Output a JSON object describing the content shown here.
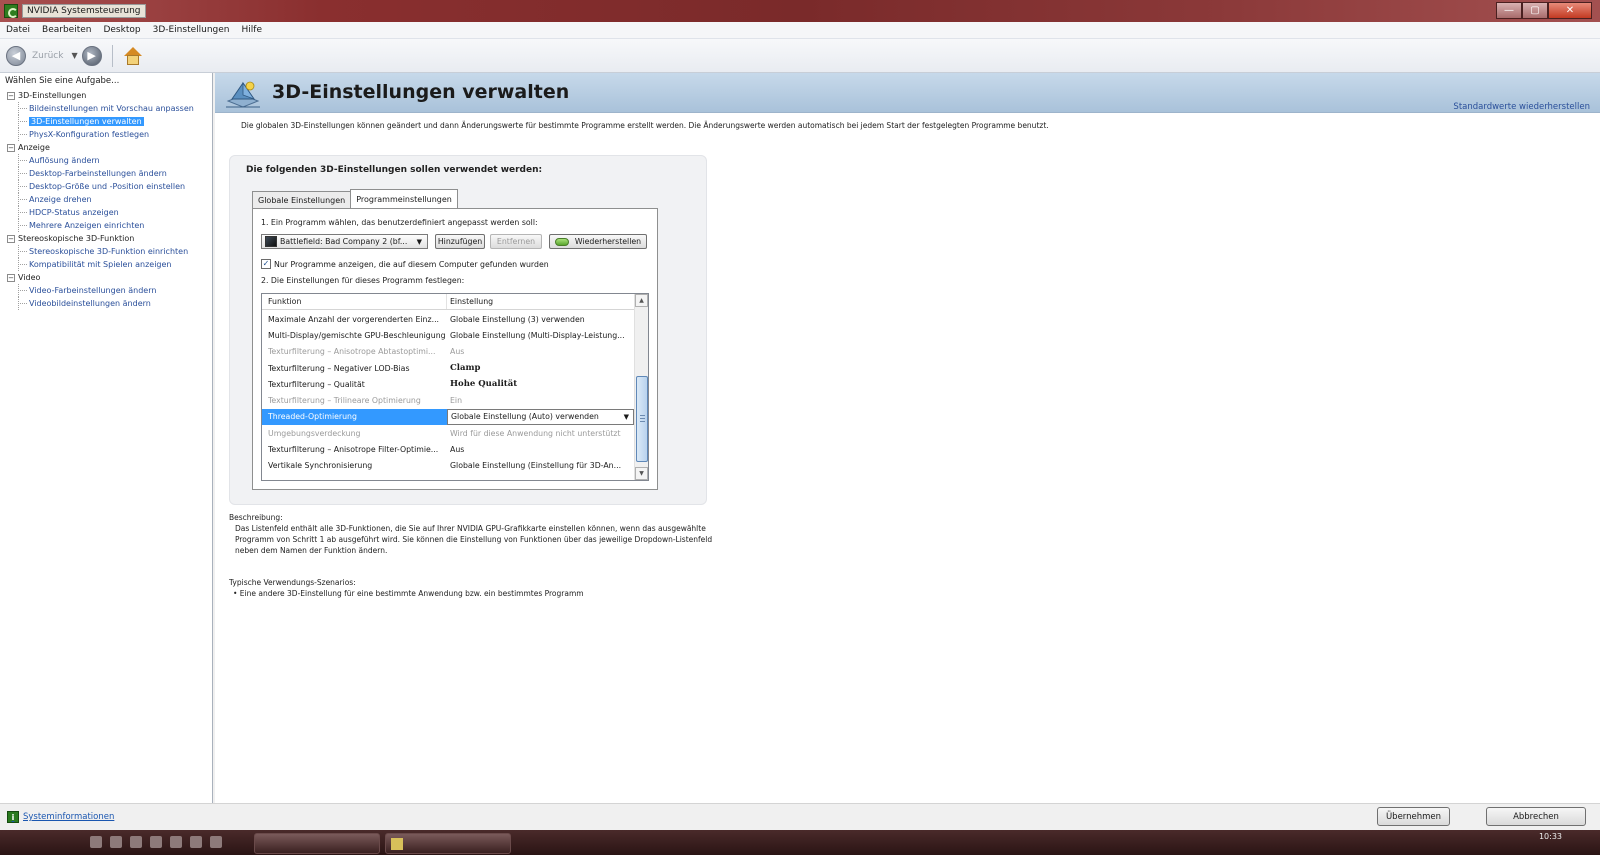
{
  "window": {
    "title": "NVIDIA Systemsteuerung",
    "controls": {
      "minimize": "—",
      "maximize": "▢",
      "close": "✕"
    }
  },
  "menu": [
    "Datei",
    "Bearbeiten",
    "Desktop",
    "3D-Einstellungen",
    "Hilfe"
  ],
  "toolbar": {
    "back_label": "Zurück",
    "back_icon": "◀",
    "forward_icon": "▶",
    "dropdown_icon": "▼"
  },
  "sidebar": {
    "title": "Wählen Sie eine Aufgabe...",
    "categories": [
      {
        "label": "3D-Einstellungen",
        "items": [
          {
            "label": "Bildeinstellungen mit Vorschau anpassen",
            "selected": false
          },
          {
            "label": "3D-Einstellungen verwalten",
            "selected": true
          },
          {
            "label": "PhysX-Konfiguration festlegen",
            "selected": false
          }
        ]
      },
      {
        "label": "Anzeige",
        "items": [
          {
            "label": "Auflösung ändern",
            "selected": false
          },
          {
            "label": "Desktop-Farbeinstellungen ändern",
            "selected": false
          },
          {
            "label": "Desktop-Größe und -Position einstellen",
            "selected": false
          },
          {
            "label": "Anzeige drehen",
            "selected": false
          },
          {
            "label": "HDCP-Status anzeigen",
            "selected": false
          },
          {
            "label": "Mehrere Anzeigen einrichten",
            "selected": false
          }
        ]
      },
      {
        "label": "Stereoskopische 3D-Funktion",
        "items": [
          {
            "label": "Stereoskopische 3D-Funktion einrichten",
            "selected": false
          },
          {
            "label": "Kompatibilität mit Spielen anzeigen",
            "selected": false
          }
        ]
      },
      {
        "label": "Video",
        "items": [
          {
            "label": "Video-Farbeinstellungen ändern",
            "selected": false
          },
          {
            "label": "Videobildeinstellungen ändern",
            "selected": false
          }
        ]
      }
    ]
  },
  "page": {
    "title": "3D-Einstellungen verwalten",
    "restore_defaults": "Standardwerte wiederherstellen",
    "intro": "Die globalen 3D-Einstellungen können geändert und dann Änderungswerte für bestimmte Programme erstellt werden. Die Änderungswerte werden automatisch bei jedem Start der festgelegten Programme benutzt.",
    "settings_title": "Die folgenden 3D-Einstellungen sollen verwendet werden:",
    "tabs": [
      {
        "label": "Globale Einstellungen",
        "active": false
      },
      {
        "label": "Programmeinstellungen",
        "active": true
      }
    ],
    "step1": "1. Ein Programm wählen, das benutzerdefiniert angepasst werden soll:",
    "program_select": "Battlefield: Bad Company 2 (bf...",
    "btn_add": "Hinzufügen",
    "btn_remove": "Entfernen",
    "btn_restore": "Wiederherstellen",
    "checkbox_label": "Nur Programme anzeigen, die auf diesem Computer gefunden wurden",
    "checkbox_checked": true,
    "step2": "2. Die Einstellungen für dieses Programm festlegen:",
    "columns": [
      "Funktion",
      "Einstellung"
    ],
    "rows": [
      {
        "function": "Maximale Anzahl der vorgerenderten Einz...",
        "setting": "Globale Einstellung (3) verwenden",
        "state": "normal"
      },
      {
        "function": "Multi-Display/gemischte GPU-Beschleunigung",
        "setting": "Globale Einstellung (Multi-Display-Leistung...",
        "state": "normal"
      },
      {
        "function": "Texturfilterung – Anisotrope Abtastoptimi...",
        "setting": "Aus",
        "state": "muted"
      },
      {
        "function": "Texturfilterung – Negativer LOD-Bias",
        "setting": "Clamp",
        "state": "bold"
      },
      {
        "function": "Texturfilterung – Qualität",
        "setting": "Hohe Qualität",
        "state": "bold"
      },
      {
        "function": "Texturfilterung – Trilineare Optimierung",
        "setting": "Ein",
        "state": "muted"
      },
      {
        "function": "Threaded-Optimierung",
        "setting": "Globale Einstellung (Auto) verwenden",
        "state": "selected"
      },
      {
        "function": "Umgebungsverdeckung",
        "setting": "Wird für diese Anwendung nicht unterstützt",
        "state": "muted"
      },
      {
        "function": "Texturfilterung – Anisotrope Filter-Optimie...",
        "setting": "Aus",
        "state": "normal"
      },
      {
        "function": "Vertikale Synchronisierung",
        "setting": "Globale Einstellung (Einstellung für 3D-An...",
        "state": "normal"
      }
    ],
    "description_label": "Beschreibung:",
    "description_text": "Das Listenfeld enthält alle 3D-Funktionen, die Sie auf Ihrer NVIDIA GPU-Grafikkarte einstellen können, wenn das ausgewählte Programm von Schritt 1 ab ausgeführt wird. Sie können die Einstellung von Funktionen über das jeweilige Dropdown-Listenfeld neben dem Namen der Funktion ändern.",
    "scenarios_label": "Typische Verwendungs-Szenarios:",
    "scenarios_text": "• Eine andere 3D-Einstellung für eine bestimmte Anwendung bzw. ein bestimmtes Programm"
  },
  "footer": {
    "sysinfo": "Systeminformationen",
    "apply": "Übernehmen",
    "cancel": "Abbrechen"
  },
  "taskbar": {
    "clock": "10:33"
  }
}
